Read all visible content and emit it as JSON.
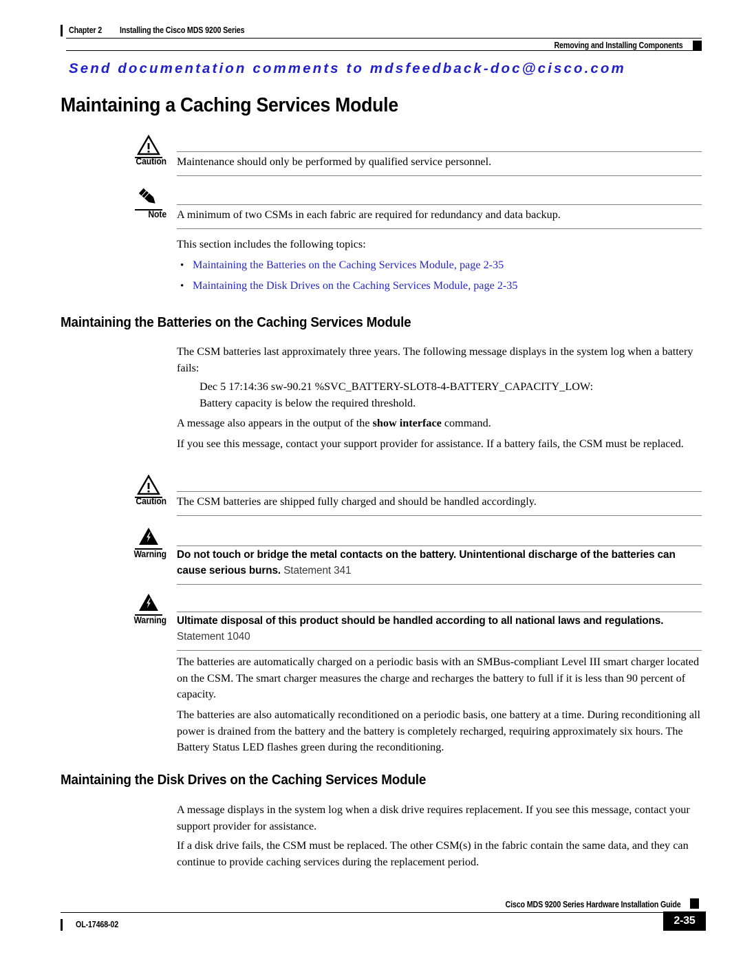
{
  "header": {
    "chapter_label": "Chapter 2",
    "chapter_title": "Installing the Cisco MDS 9200 Series",
    "section_title": "Removing and Installing Components"
  },
  "feedback_banner": {
    "text": "Send documentation comments to mdsfeedback-doc@cisco.com",
    "color": "#2020CC"
  },
  "main": {
    "title": "Maintaining a Caching Services Module",
    "caution_1": {
      "label": "Caution",
      "icon": "caution-triangle-icon",
      "text": "Maintenance should only be performed by qualified service personnel."
    },
    "note_1": {
      "label": "Note",
      "icon": "note-pencil-icon",
      "text": "A minimum of two CSMs in each fabric are required for redundancy and data backup."
    },
    "intro": "This section includes the following topics:",
    "topics": [
      {
        "bullet": "•",
        "label": "Maintaining the Batteries on the Caching Services Module, page 2-35"
      },
      {
        "bullet": "•",
        "label": "Maintaining the Disk Drives on the Caching Services Module, page 2-35"
      }
    ],
    "batteries_section": {
      "heading": "Maintaining the Batteries on the Caching Services Module",
      "p1": "The CSM batteries last approximately three years. The following message displays in the system log when a battery fails:",
      "syslog_line1": "Dec 5 17:14:36 sw-90.21 %SVC_BATTERY-SLOT8-4-BATTERY_CAPACITY_LOW:",
      "syslog_line2": "Battery capacity is below the required threshold.",
      "p2_before": "A message also appears in the output of the ",
      "p2_bold": "show interface",
      "p2_after": " command.",
      "p3": "If you see this message, contact your support provider for assistance. If a battery fails, the CSM must be replaced.",
      "caution_2": {
        "label": "Caution",
        "icon": "caution-triangle-icon",
        "text": "The CSM batteries are shipped fully charged and should be handled accordingly."
      },
      "warning_1": {
        "label": "Warning",
        "icon": "warning-lightning-icon",
        "bold_text": "Do not touch or bridge the metal contacts on the battery. Unintentional discharge of the batteries can cause serious burns.",
        "statement": "Statement 341"
      },
      "warning_2": {
        "label": "Warning",
        "icon": "warning-lightning-icon",
        "bold_text": "Ultimate disposal of this product should be handled according to all national laws and regulations.",
        "statement": "Statement 1040"
      },
      "p4": "The batteries are automatically charged on a periodic basis with an SMBus-compliant Level III smart charger located on the CSM. The smart charger measures the charge and recharges the battery to full if it is less than 90 percent of capacity.",
      "p5": "The batteries are also automatically reconditioned on a periodic basis, one battery at a time. During reconditioning all power is drained from the battery and the battery is completely recharged, requiring approximately six hours. The Battery Status LED flashes green during the reconditioning."
    },
    "disk_section": {
      "heading": "Maintaining the Disk Drives on the Caching Services Module",
      "p1": "A message displays in the system log when a disk drive requires replacement. If you see this message, contact your support provider for assistance.",
      "p2": "If a disk drive fails, the CSM must be replaced. The other CSM(s) in the fabric contain the same data, and they can continue to provide caching services during the replacement period."
    }
  },
  "footer": {
    "guide_title": "Cisco MDS 9200 Series Hardware Installation Guide",
    "doc_id": "OL-17468-02",
    "page_number": "2-35"
  }
}
